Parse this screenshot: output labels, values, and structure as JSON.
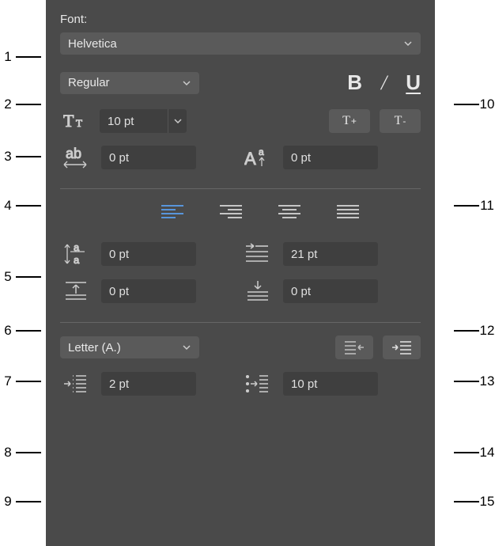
{
  "font": {
    "label": "Font:",
    "family": "Helvetica",
    "weight": "Regular",
    "size": "10 pt",
    "tracking": "0 pt",
    "baseline": "0 pt"
  },
  "buttons": {
    "increase_size": "T+",
    "decrease_size": "T-"
  },
  "paragraph": {
    "line_spacing": "0 pt",
    "before_paragraph": "0 pt",
    "first_line_indent": "21 pt",
    "after_paragraph": "0 pt"
  },
  "list": {
    "style": "Letter (A.)",
    "text_indent": "2 pt",
    "bullet_indent": "10 pt"
  },
  "callouts": {
    "1": "1",
    "2": "2",
    "3": "3",
    "4": "4",
    "5": "5",
    "6": "6",
    "7": "7",
    "8": "8",
    "9": "9",
    "10": "10",
    "11": "11",
    "12": "12",
    "13": "13",
    "14": "14",
    "15": "15"
  }
}
